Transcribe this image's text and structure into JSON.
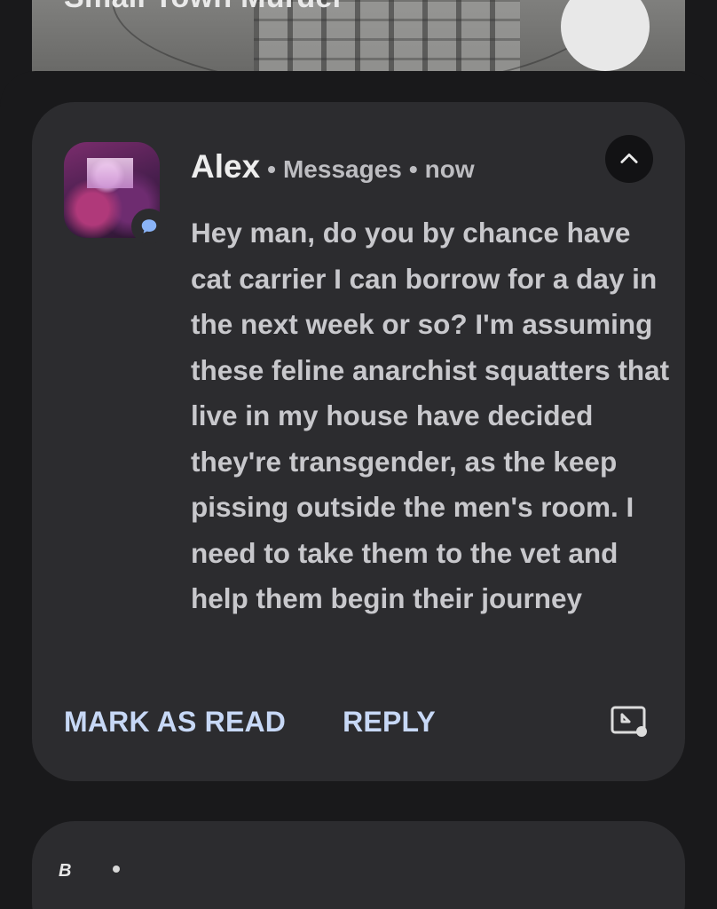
{
  "media_card": {
    "title": "Small Town Murder"
  },
  "notification": {
    "sender": "Alex",
    "app_name": "Messages",
    "time": "now",
    "separator": "•",
    "message": "Hey man, do you by chance have cat carrier I can borrow for a day in the next week or so? I'm assuming these feline anarchist squatters that live in my house have decided they're transgender, as the keep pissing outside the men's room. I need to take them to the vet and help them begin their journey",
    "actions": {
      "mark_as_read": "MARK AS READ",
      "reply": "REPLY"
    },
    "icons": {
      "badge": "messages-bubble-icon",
      "expand": "chevron-up-icon",
      "bubble": "open-in-bubble-icon"
    },
    "colors": {
      "card": "#2c2c2f",
      "action_text": "#c7d8f6",
      "badge": "#8ab4f8"
    }
  },
  "second_notification": {
    "app_icon_text": "B"
  }
}
